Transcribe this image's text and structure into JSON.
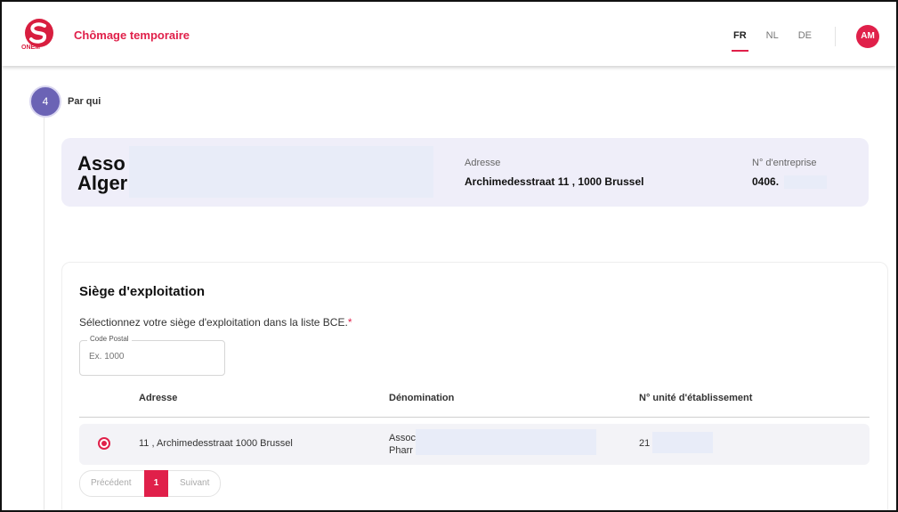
{
  "header": {
    "logo_text": "ONEM",
    "app_title": "Chômage temporaire",
    "languages": [
      "FR",
      "NL",
      "DE"
    ],
    "active_language": "FR",
    "avatar_initials": "AM",
    "brand_color": "#e0204a"
  },
  "step": {
    "number": "4",
    "label": "Par qui"
  },
  "company": {
    "name_line1": "Asso",
    "name_line2": "Alger",
    "address_label": "Adresse",
    "address_value": "Archimedesstraat 11 , 1000 Brussel",
    "enterprise_label": "N° d'entreprise",
    "enterprise_value": "0406."
  },
  "section": {
    "title": "Siège d'exploitation",
    "instructions": "Sélectionnez votre siège d'exploitation dans la liste BCE.",
    "required_marker": "*",
    "postal": {
      "label": "Code Postal",
      "placeholder": "Ex. 1000",
      "value": ""
    },
    "table": {
      "headers": [
        "Adresse",
        "Dénomination",
        "N° unité d'établissement"
      ],
      "rows": [
        {
          "selected": true,
          "address": "11 , Archimedesstraat 1000 Brussel",
          "denomination_line1": "Assoc",
          "denomination_line2": "Pharr",
          "unit_number": "21"
        }
      ]
    },
    "pagination": {
      "previous": "Précédent",
      "current_page": "1",
      "next": "Suivant"
    }
  }
}
